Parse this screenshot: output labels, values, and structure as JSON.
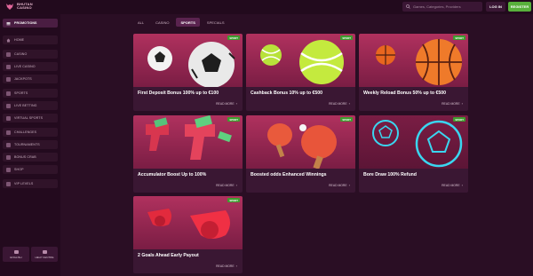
{
  "brand": {
    "line1": "BHUTAN",
    "line2": "CASINO"
  },
  "header": {
    "search_placeholder": "Games, Categories, Providers",
    "login_label": "LOG IN",
    "register_label": "REGISTER"
  },
  "sidebar": {
    "items": [
      {
        "label": "PROMOTIONS",
        "icon": "promotions-icon"
      },
      {
        "label": "HOME",
        "icon": "home-icon"
      },
      {
        "label": "CASINO",
        "icon": "cards-icon"
      },
      {
        "label": "LIVE CASINO",
        "icon": "live-casino-icon"
      },
      {
        "label": "JACKPOTS",
        "icon": "jackpot-icon"
      },
      {
        "label": "SPORTS",
        "icon": "sports-icon"
      },
      {
        "label": "LIVE BETTING",
        "icon": "live-betting-icon"
      },
      {
        "label": "VIRTUAL SPORTS",
        "icon": "virtual-sports-icon"
      },
      {
        "label": "CHALLENGES",
        "icon": "challenges-icon"
      },
      {
        "label": "TOURNAMENTS",
        "icon": "trophy-icon"
      },
      {
        "label": "BONUS CRAB",
        "icon": "crab-icon"
      },
      {
        "label": "SHOP",
        "icon": "shop-icon"
      },
      {
        "label": "VIP LEVELS",
        "icon": "vip-icon"
      }
    ],
    "bottom": [
      {
        "label": "ENGLISH",
        "icon": "language-icon"
      },
      {
        "label": "HELP CENTRE",
        "icon": "help-icon"
      }
    ]
  },
  "tabs": [
    {
      "label": "ALL"
    },
    {
      "label": "CASINO"
    },
    {
      "label": "SPORTS",
      "active": true
    },
    {
      "label": "SPECIALS"
    }
  ],
  "cards": [
    {
      "title": "First Deposit Bonus 100% up to €100",
      "badge": "SPORT",
      "more": "READ MORE",
      "art": "soccer-balls"
    },
    {
      "title": "Cashback Bonus 10% up to €500",
      "badge": "SPORT",
      "more": "READ MORE",
      "art": "tennis-balls"
    },
    {
      "title": "Weekly Reload Bonus 50% up to €500",
      "badge": "SPORT",
      "more": "READ MORE",
      "art": "basketballs"
    },
    {
      "title": "Accumulator Boost Up to 100%",
      "badge": "SPORT",
      "more": "READ MORE",
      "art": "money-guns"
    },
    {
      "title": "Boosted odds Enhanced Winnings",
      "badge": "SPORT",
      "more": "READ MORE",
      "art": "ping-pong"
    },
    {
      "title": "Bore Draw 100% Refund",
      "badge": "SPORT",
      "more": "READ MORE",
      "art": "neon-balls"
    },
    {
      "title": "2 Goals Ahead Early Payout",
      "badge": "SPORT",
      "more": "READ MORE",
      "art": "whistles"
    }
  ],
  "colors": {
    "background": "#2a0e24",
    "sidebar": "#230a1e",
    "card": "#3a1733",
    "badge": "#3f9c2f",
    "register": "#58b03b",
    "tab_active": "#5a234f"
  }
}
